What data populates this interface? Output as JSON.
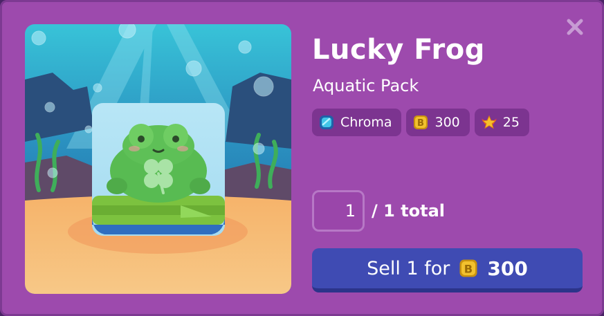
{
  "item": {
    "name": "Lucky Frog",
    "pack": "Aquatic Pack"
  },
  "badges": [
    {
      "icon": "chroma-gem-icon",
      "label": "Chroma"
    },
    {
      "icon": "coin-icon",
      "label": "300"
    },
    {
      "icon": "star-wings-icon",
      "label": "25"
    }
  ],
  "quantity": {
    "value": "1",
    "total_text": "/ 1 total"
  },
  "sell_button": {
    "label": "Sell 1 for",
    "amount": "300",
    "icon": "coin-icon"
  },
  "close_icon": "close-icon",
  "colors": {
    "panel": "#9d4aad",
    "badge": "#7c3490",
    "sell_button": "#3f4bb3",
    "coin": "#f2c12e"
  }
}
